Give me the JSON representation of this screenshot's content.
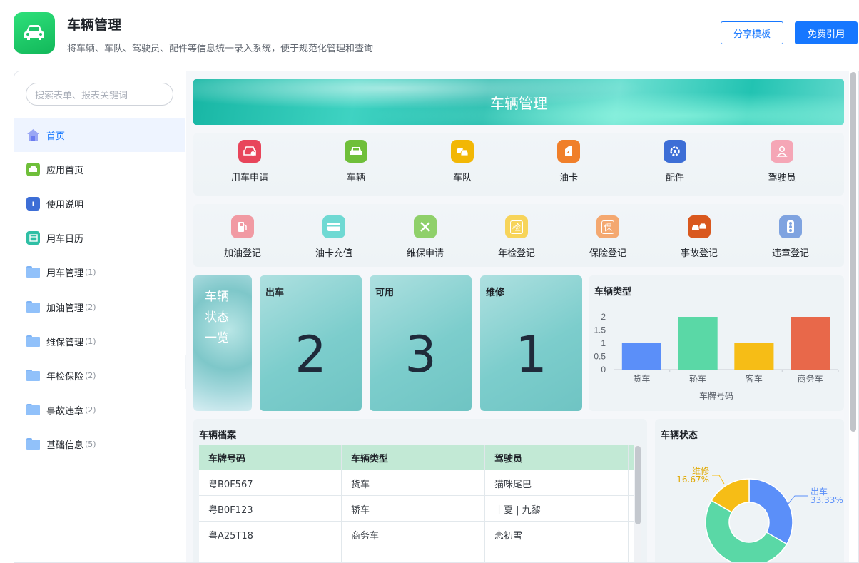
{
  "header": {
    "title": "车辆管理",
    "description": "将车辆、车队、驾驶员、配件等信息统一录入系统，便于规范化管理和查询",
    "share_label": "分享模板",
    "use_label": "免费引用"
  },
  "sidebar": {
    "search_placeholder": "搜索表单、报表关键词",
    "items": [
      {
        "label": "首页",
        "icon": "home-icon"
      },
      {
        "label": "应用首页",
        "icon": "car-icon"
      },
      {
        "label": "使用说明",
        "icon": "info-icon"
      },
      {
        "label": "用车日历",
        "icon": "calendar-icon"
      },
      {
        "label": "用车管理",
        "count": "(1)",
        "icon": "folder-icon"
      },
      {
        "label": "加油管理",
        "count": "(2)",
        "icon": "folder-icon"
      },
      {
        "label": "维保管理",
        "count": "(1)",
        "icon": "folder-icon"
      },
      {
        "label": "年检保险",
        "count": "(2)",
        "icon": "folder-icon"
      },
      {
        "label": "事故违章",
        "count": "(2)",
        "icon": "folder-icon"
      },
      {
        "label": "基础信息",
        "count": "(5)",
        "icon": "folder-icon"
      }
    ]
  },
  "banner": {
    "title": "车辆管理"
  },
  "shortcuts_row1": [
    {
      "label": "用车申请",
      "icon": "car-request-icon",
      "color": "#e8455b"
    },
    {
      "label": "车辆",
      "icon": "car-icon",
      "color": "#6fbf3a"
    },
    {
      "label": "车队",
      "icon": "fleet-icon",
      "color": "#f2b705"
    },
    {
      "label": "油卡",
      "icon": "fuel-card-icon",
      "color": "#f07f2a"
    },
    {
      "label": "配件",
      "icon": "gear-icon",
      "color": "#3d6ed6"
    },
    {
      "label": "驾驶员",
      "icon": "driver-icon",
      "color": "#f5a6b6"
    }
  ],
  "shortcuts_row2": [
    {
      "label": "加油登记",
      "icon": "fuel-pump-icon",
      "color": "#f19aa3"
    },
    {
      "label": "油卡充值",
      "icon": "card-icon",
      "color": "#6fd9d3"
    },
    {
      "label": "维保申请",
      "icon": "wrench-icon",
      "color": "#8fd06a"
    },
    {
      "label": "年检登记",
      "icon": "inspection-icon",
      "color": "#f7d45a",
      "glyph": "检"
    },
    {
      "label": "保险登记",
      "icon": "insurance-icon",
      "color": "#f4a870",
      "glyph": "保"
    },
    {
      "label": "事故登记",
      "icon": "accident-icon",
      "color": "#d9581e"
    },
    {
      "label": "违章登记",
      "icon": "traffic-light-icon",
      "color": "#7fa3e0"
    }
  ],
  "status": {
    "title": "车辆状态一览",
    "title_lines": [
      "车辆",
      "状态",
      "一览"
    ],
    "cards": [
      {
        "label": "出车",
        "value": "2"
      },
      {
        "label": "可用",
        "value": "3"
      },
      {
        "label": "维修",
        "value": "1"
      }
    ]
  },
  "type_chart": {
    "title": "车辆类型",
    "xlabel": "车牌号码",
    "tick_labels": [
      "0",
      "0.5",
      "1",
      "1.5",
      "2"
    ]
  },
  "archive": {
    "title": "车辆档案",
    "columns": [
      "车牌号码",
      "车辆类型",
      "驾驶员"
    ],
    "rows": [
      [
        "粤B0F567",
        "货车",
        "猫咪尾巴"
      ],
      [
        "粤B0F123",
        "轿车",
        "十夏 | 九黎"
      ],
      [
        "粤A25T18",
        "商务车",
        "恋初雪"
      ],
      [
        "",
        "",
        ""
      ]
    ]
  },
  "state_chart": {
    "title": "车辆状态",
    "label_out": "出车",
    "pct_out": "33.33%",
    "label_repair": "维修",
    "pct_repair": "16.67%"
  },
  "chart_data": [
    {
      "type": "bar",
      "title": "车辆类型",
      "xlabel": "车牌号码",
      "ylabel": "",
      "categories": [
        "货车",
        "轿车",
        "客车",
        "商务车"
      ],
      "values": [
        1,
        2,
        1,
        2
      ],
      "ylim": [
        0,
        2
      ],
      "colors": [
        "#5b8ff9",
        "#5ad8a6",
        "#f6bd16",
        "#e8684a"
      ],
      "grid": false
    },
    {
      "type": "pie",
      "title": "车辆状态",
      "categories": [
        "出车",
        "可用",
        "维修"
      ],
      "values": [
        2,
        3,
        1
      ],
      "percent_labels": [
        "33.33%",
        "",
        "16.67%"
      ],
      "colors": [
        "#5b8ff9",
        "#5ad8a6",
        "#f6bd16"
      ]
    }
  ]
}
